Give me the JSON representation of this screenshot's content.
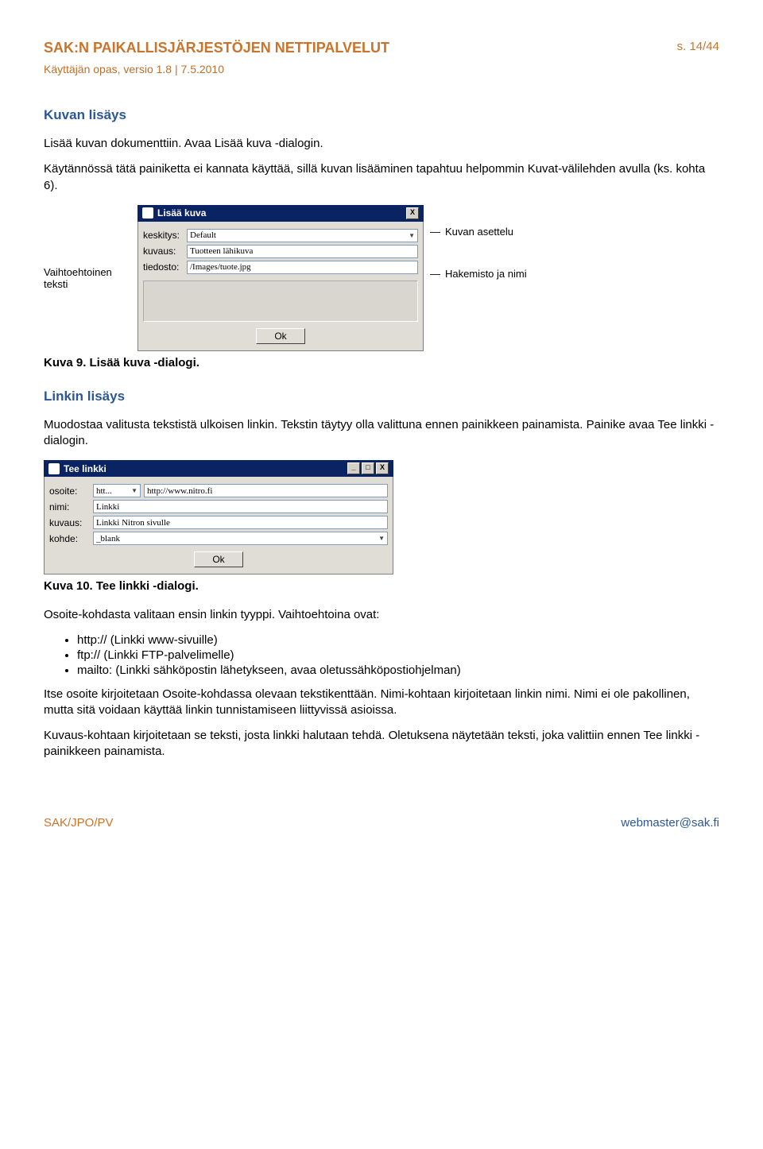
{
  "header": {
    "title": "SAK:N PAIKALLISJÄRJESTÖJEN NETTIPALVELUT",
    "page": "s. 14/44",
    "sub": "Käyttäjän opas, versio 1.8 | 7.5.2010"
  },
  "s1": {
    "title": "Kuvan lisäys",
    "p1": "Lisää kuvan dokumenttiin. Avaa Lisää kuva -dialogin.",
    "p2": "Käytännössä tätä painiketta ei kannata käyttää, sillä kuvan lisääminen tapahtuu helpommin Kuvat-välilehden avulla (ks. kohta 6)."
  },
  "fig9": {
    "leftnote": "Vaihtoehtoinen teksti",
    "dialog": {
      "title": "Lisää kuva",
      "close": "X",
      "rows": {
        "keskitys_label": "keskitys:",
        "keskitys_value": "Default",
        "kuvaus_label": "kuvaus:",
        "kuvaus_value": "Tuotteen lähikuva",
        "tiedosto_label": "tiedosto:",
        "tiedosto_value": "/Images/tuote.jpg"
      },
      "ok": "Ok"
    },
    "annot1": "Kuvan asettelu",
    "annot2": "Hakemisto ja nimi",
    "caption": "Kuva 9. Lisää kuva -dialogi."
  },
  "s2": {
    "title": "Linkin lisäys",
    "p1": "Muodostaa valitusta tekstistä ulkoisen linkin. Tekstin täytyy olla valittuna ennen painikkeen painamista. Painike avaa Tee linkki -dialogin."
  },
  "fig10": {
    "dialog": {
      "title": "Tee linkki",
      "min": "_",
      "max": "□",
      "close": "X",
      "rows": {
        "osoite_label": "osoite:",
        "osoite_scheme": "htt...",
        "osoite_value": "http://www.nitro.fi",
        "nimi_label": "nimi:",
        "nimi_value": "Linkki",
        "kuvaus_label": "kuvaus:",
        "kuvaus_value": "Linkki Nitron sivulle",
        "kohde_label": "kohde:",
        "kohde_value": "_blank"
      },
      "ok": "Ok"
    },
    "caption": "Kuva 10. Tee linkki -dialogi."
  },
  "s3": {
    "p1": "Osoite-kohdasta valitaan ensin linkin tyyppi. Vaihtoehtoina ovat:",
    "li1": "http:// (Linkki www-sivuille)",
    "li2": "ftp:// (Linkki FTP-palvelimelle)",
    "li3": "mailto: (Linkki sähköpostin lähetykseen, avaa oletussähköpostiohjelman)",
    "p2": "Itse osoite kirjoitetaan Osoite-kohdassa olevaan tekstikenttään. Nimi-kohtaan kirjoitetaan linkin nimi. Nimi ei ole pakollinen, mutta sitä voidaan käyttää linkin tunnistamiseen liittyvissä asioissa.",
    "p3": "Kuvaus-kohtaan kirjoitetaan se teksti, josta linkki halutaan tehdä. Oletuksena näytetään teksti, joka valittiin ennen Tee linkki -painikkeen painamista."
  },
  "footer": {
    "left": "SAK/JPO/PV",
    "right": "webmaster@sak.fi"
  }
}
